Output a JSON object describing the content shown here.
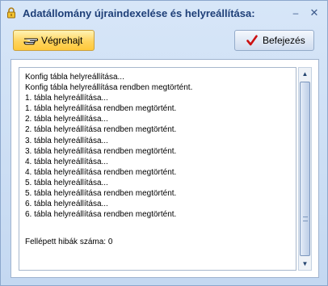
{
  "window": {
    "title": "Adatállomány újraindexelése és helyreállítása:",
    "title_icon": "padlock-icon",
    "controls": {
      "minimize": "–",
      "close": "✕"
    }
  },
  "toolbar": {
    "execute_label": "Végrehajt",
    "execute_icon": "pointing-hand-icon",
    "finish_label": "Befejezés",
    "finish_icon": "checkmark-icon"
  },
  "log": {
    "lines": [
      "Konfig tábla helyreállítása...",
      "Konfig tábla helyreállítása rendben megtörtént.",
      "1. tábla helyreállítása...",
      "1. tábla helyreállítása rendben megtörtént.",
      "2. tábla helyreállítása...",
      "2. tábla helyreállítása rendben megtörtént.",
      "3. tábla helyreállítása...",
      "3. tábla helyreállítása rendben megtörtént.",
      "4. tábla helyreállítása...",
      "4. tábla helyreállítása rendben megtörtént.",
      "5. tábla helyreállítása...",
      "5. tábla helyreállítása rendben megtörtént.",
      "6. tábla helyreállítása...",
      "6. tábla helyreállítása rendben megtörtént."
    ],
    "error_summary": "Fellépett hibák száma: 0"
  },
  "scrollbar": {
    "up": "▲",
    "down": "▼"
  },
  "colors": {
    "title_text": "#1e3f78",
    "execute_button": "#ffd45e",
    "finish_check": "#cc1010",
    "frame": "#c4d8f1"
  }
}
